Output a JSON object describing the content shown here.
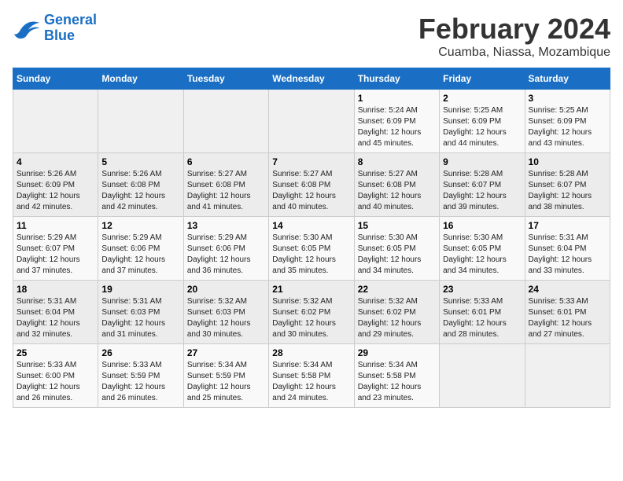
{
  "header": {
    "logo": {
      "line1": "General",
      "line2": "Blue"
    },
    "title": "February 2024",
    "location": "Cuamba, Niassa, Mozambique"
  },
  "weekdays": [
    "Sunday",
    "Monday",
    "Tuesday",
    "Wednesday",
    "Thursday",
    "Friday",
    "Saturday"
  ],
  "weeks": [
    [
      {
        "day": "",
        "info": ""
      },
      {
        "day": "",
        "info": ""
      },
      {
        "day": "",
        "info": ""
      },
      {
        "day": "",
        "info": ""
      },
      {
        "day": "1",
        "info": "Sunrise: 5:24 AM\nSunset: 6:09 PM\nDaylight: 12 hours\nand 45 minutes."
      },
      {
        "day": "2",
        "info": "Sunrise: 5:25 AM\nSunset: 6:09 PM\nDaylight: 12 hours\nand 44 minutes."
      },
      {
        "day": "3",
        "info": "Sunrise: 5:25 AM\nSunset: 6:09 PM\nDaylight: 12 hours\nand 43 minutes."
      }
    ],
    [
      {
        "day": "4",
        "info": "Sunrise: 5:26 AM\nSunset: 6:09 PM\nDaylight: 12 hours\nand 42 minutes."
      },
      {
        "day": "5",
        "info": "Sunrise: 5:26 AM\nSunset: 6:08 PM\nDaylight: 12 hours\nand 42 minutes."
      },
      {
        "day": "6",
        "info": "Sunrise: 5:27 AM\nSunset: 6:08 PM\nDaylight: 12 hours\nand 41 minutes."
      },
      {
        "day": "7",
        "info": "Sunrise: 5:27 AM\nSunset: 6:08 PM\nDaylight: 12 hours\nand 40 minutes."
      },
      {
        "day": "8",
        "info": "Sunrise: 5:27 AM\nSunset: 6:08 PM\nDaylight: 12 hours\nand 40 minutes."
      },
      {
        "day": "9",
        "info": "Sunrise: 5:28 AM\nSunset: 6:07 PM\nDaylight: 12 hours\nand 39 minutes."
      },
      {
        "day": "10",
        "info": "Sunrise: 5:28 AM\nSunset: 6:07 PM\nDaylight: 12 hours\nand 38 minutes."
      }
    ],
    [
      {
        "day": "11",
        "info": "Sunrise: 5:29 AM\nSunset: 6:07 PM\nDaylight: 12 hours\nand 37 minutes."
      },
      {
        "day": "12",
        "info": "Sunrise: 5:29 AM\nSunset: 6:06 PM\nDaylight: 12 hours\nand 37 minutes."
      },
      {
        "day": "13",
        "info": "Sunrise: 5:29 AM\nSunset: 6:06 PM\nDaylight: 12 hours\nand 36 minutes."
      },
      {
        "day": "14",
        "info": "Sunrise: 5:30 AM\nSunset: 6:05 PM\nDaylight: 12 hours\nand 35 minutes."
      },
      {
        "day": "15",
        "info": "Sunrise: 5:30 AM\nSunset: 6:05 PM\nDaylight: 12 hours\nand 34 minutes."
      },
      {
        "day": "16",
        "info": "Sunrise: 5:30 AM\nSunset: 6:05 PM\nDaylight: 12 hours\nand 34 minutes."
      },
      {
        "day": "17",
        "info": "Sunrise: 5:31 AM\nSunset: 6:04 PM\nDaylight: 12 hours\nand 33 minutes."
      }
    ],
    [
      {
        "day": "18",
        "info": "Sunrise: 5:31 AM\nSunset: 6:04 PM\nDaylight: 12 hours\nand 32 minutes."
      },
      {
        "day": "19",
        "info": "Sunrise: 5:31 AM\nSunset: 6:03 PM\nDaylight: 12 hours\nand 31 minutes."
      },
      {
        "day": "20",
        "info": "Sunrise: 5:32 AM\nSunset: 6:03 PM\nDaylight: 12 hours\nand 30 minutes."
      },
      {
        "day": "21",
        "info": "Sunrise: 5:32 AM\nSunset: 6:02 PM\nDaylight: 12 hours\nand 30 minutes."
      },
      {
        "day": "22",
        "info": "Sunrise: 5:32 AM\nSunset: 6:02 PM\nDaylight: 12 hours\nand 29 minutes."
      },
      {
        "day": "23",
        "info": "Sunrise: 5:33 AM\nSunset: 6:01 PM\nDaylight: 12 hours\nand 28 minutes."
      },
      {
        "day": "24",
        "info": "Sunrise: 5:33 AM\nSunset: 6:01 PM\nDaylight: 12 hours\nand 27 minutes."
      }
    ],
    [
      {
        "day": "25",
        "info": "Sunrise: 5:33 AM\nSunset: 6:00 PM\nDaylight: 12 hours\nand 26 minutes."
      },
      {
        "day": "26",
        "info": "Sunrise: 5:33 AM\nSunset: 5:59 PM\nDaylight: 12 hours\nand 26 minutes."
      },
      {
        "day": "27",
        "info": "Sunrise: 5:34 AM\nSunset: 5:59 PM\nDaylight: 12 hours\nand 25 minutes."
      },
      {
        "day": "28",
        "info": "Sunrise: 5:34 AM\nSunset: 5:58 PM\nDaylight: 12 hours\nand 24 minutes."
      },
      {
        "day": "29",
        "info": "Sunrise: 5:34 AM\nSunset: 5:58 PM\nDaylight: 12 hours\nand 23 minutes."
      },
      {
        "day": "",
        "info": ""
      },
      {
        "day": "",
        "info": ""
      }
    ]
  ]
}
